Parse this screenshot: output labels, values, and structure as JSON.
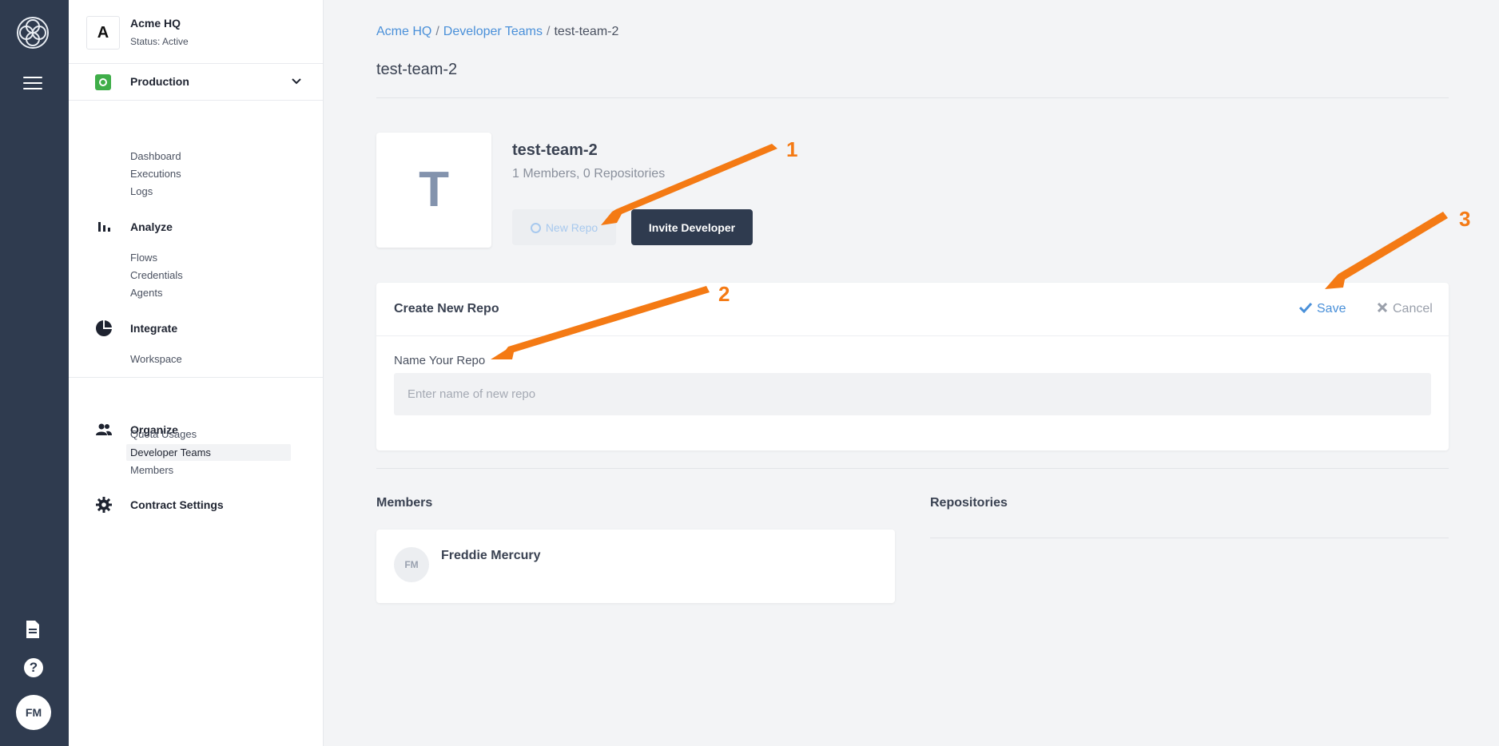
{
  "rail": {
    "avatar_initials": "FM",
    "help_glyph": "?"
  },
  "sidebar": {
    "org_initial": "A",
    "org_name": "Acme HQ",
    "org_status": "Status: Active",
    "environment": "Production",
    "groups": [
      {
        "title": "Analyze",
        "icon": "bar-chart-icon",
        "items": [
          "Dashboard",
          "Executions",
          "Logs"
        ]
      },
      {
        "title": "Integrate",
        "icon": "pie-chart-icon",
        "items": [
          "Flows",
          "Credentials",
          "Agents"
        ]
      },
      {
        "title": "Organize",
        "icon": "people-icon",
        "items": [
          "Workspace"
        ]
      },
      {
        "title": "Contract Settings",
        "icon": "gear-icon",
        "items": [
          "Quota Usages",
          "Developer Teams",
          "Members"
        ]
      }
    ],
    "active_item": "Developer Teams"
  },
  "breadcrumb": {
    "items": [
      "Acme HQ",
      "Developer Teams"
    ],
    "current": "test-team-2",
    "separator": "/"
  },
  "page_title": "test-team-2",
  "team": {
    "initial": "T",
    "name": "test-team-2",
    "meta": "1 Members, 0 Repositories",
    "new_repo_label": "New Repo",
    "invite_label": "Invite Developer"
  },
  "create_repo": {
    "title": "Create New Repo",
    "save_label": "Save",
    "cancel_label": "Cancel",
    "field_label": "Name Your Repo",
    "field_placeholder": "Enter name of new repo",
    "field_value": ""
  },
  "members_section": {
    "title": "Members",
    "members": [
      {
        "initials": "FM",
        "name": "Freddie Mercury"
      }
    ]
  },
  "repositories_section": {
    "title": "Repositories"
  },
  "annotations": {
    "labels": [
      "1",
      "2",
      "3"
    ],
    "color": "#f47a14"
  },
  "colors": {
    "rail": "#2f3b4f",
    "accent": "#4a90d9",
    "production": "#3fae49",
    "primary_button": "#2f3b4f"
  }
}
